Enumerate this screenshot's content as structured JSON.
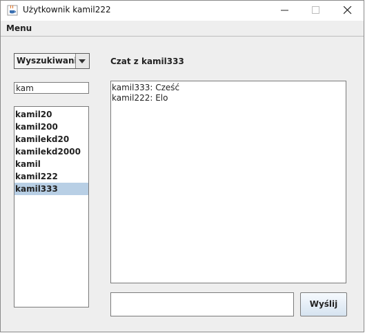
{
  "window": {
    "title": "Użytkownik kamil222",
    "icon": "java-cup-icon"
  },
  "menubar": {
    "items": [
      {
        "label": "Menu"
      }
    ]
  },
  "sidebar": {
    "mode_select": {
      "value": "Wyszukiwanie"
    },
    "search": {
      "value": "kam"
    },
    "users": [
      {
        "label": "kamil20",
        "selected": false
      },
      {
        "label": "kamil200",
        "selected": false
      },
      {
        "label": "kamilekd20",
        "selected": false
      },
      {
        "label": "kamilekd2000",
        "selected": false
      },
      {
        "label": "kamil",
        "selected": false
      },
      {
        "label": "kamil222",
        "selected": false
      },
      {
        "label": "kamil333",
        "selected": true
      }
    ]
  },
  "chat": {
    "header": "Czat z kamil333",
    "messages": [
      {
        "text": "kamil333: Cześć"
      },
      {
        "text": "kamil222: Elo"
      }
    ],
    "input_value": "",
    "send_label": "Wyślij"
  },
  "colors": {
    "selection": "#b8cfe5",
    "panel": "#eeeeee"
  }
}
